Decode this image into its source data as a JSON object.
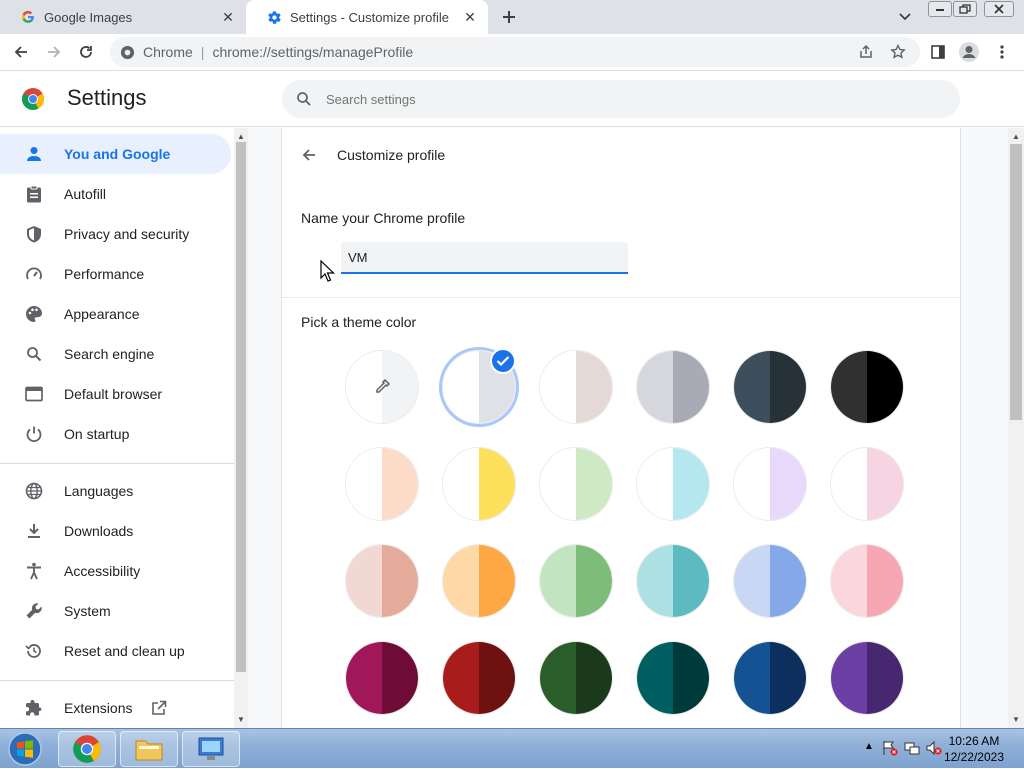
{
  "tabs": [
    {
      "title": "Google Images",
      "icon": "google-g-icon"
    },
    {
      "title": "Settings - Customize profile",
      "icon": "settings-gear-icon"
    }
  ],
  "toolbar": {
    "site_name": "Chrome",
    "separator": "|",
    "url": "chrome://settings/manageProfile"
  },
  "header": {
    "title": "Settings",
    "search_placeholder": "Search settings"
  },
  "sidebar": {
    "items": [
      {
        "label": "You and Google",
        "icon": "person-icon",
        "active": true
      },
      {
        "label": "Autofill",
        "icon": "clipboard-icon"
      },
      {
        "label": "Privacy and security",
        "icon": "shield-icon"
      },
      {
        "label": "Performance",
        "icon": "speedometer-icon"
      },
      {
        "label": "Appearance",
        "icon": "palette-icon"
      },
      {
        "label": "Search engine",
        "icon": "search-icon"
      },
      {
        "label": "Default browser",
        "icon": "browser-window-icon"
      },
      {
        "label": "On startup",
        "icon": "power-icon"
      },
      {
        "label": "Languages",
        "icon": "globe-icon"
      },
      {
        "label": "Downloads",
        "icon": "download-icon"
      },
      {
        "label": "Accessibility",
        "icon": "accessibility-icon"
      },
      {
        "label": "System",
        "icon": "wrench-icon"
      },
      {
        "label": "Reset and clean up",
        "icon": "history-reset-icon"
      },
      {
        "label": "Extensions",
        "icon": "puzzle-icon",
        "external": true
      }
    ]
  },
  "main": {
    "subtitle": "Customize profile",
    "name_label": "Name your Chrome profile",
    "name_value": "VM",
    "color_label": "Pick a theme color",
    "selected_swatch_index": 1,
    "swatches": [
      {
        "left": "#ffffff",
        "right": "#f1f3f4",
        "type": "custom"
      },
      {
        "left": "#ffffff",
        "right": "#dee1e6"
      },
      {
        "left": "#ffffff",
        "right": "#e5d9d7"
      },
      {
        "left": "#d6d7dc",
        "right": "#a8abb5"
      },
      {
        "left": "#3d4f5c",
        "right": "#263238"
      },
      {
        "left": "#303030",
        "right": "#000000"
      },
      {
        "left": "#ffffff",
        "right": "#fcdbc8"
      },
      {
        "left": "#ffffff",
        "right": "#fde15d"
      },
      {
        "left": "#ffffff",
        "right": "#cdeac4"
      },
      {
        "left": "#ffffff",
        "right": "#b5e7f0"
      },
      {
        "left": "#ffffff",
        "right": "#e8d9fb"
      },
      {
        "left": "#ffffff",
        "right": "#f7d4e2"
      },
      {
        "left": "#f2d8d2",
        "right": "#e4ab9b"
      },
      {
        "left": "#fed8a6",
        "right": "#fda745"
      },
      {
        "left": "#c3e4c0",
        "right": "#7dbd7a"
      },
      {
        "left": "#ace0e3",
        "right": "#5dbac0"
      },
      {
        "left": "#c7d7f4",
        "right": "#85a9e8"
      },
      {
        "left": "#fbd6dc",
        "right": "#f7a7b3"
      },
      {
        "left": "#a0175a",
        "right": "#6e0c37"
      },
      {
        "left": "#a81c1c",
        "right": "#6d1111"
      },
      {
        "left": "#2a5d2a",
        "right": "#1b3a1b"
      },
      {
        "left": "#005f60",
        "right": "#003b3c"
      },
      {
        "left": "#155293",
        "right": "#0c2f5d"
      },
      {
        "left": "#6c3fa5",
        "right": "#472770"
      }
    ]
  },
  "taskbar": {
    "time": "10:26 AM",
    "date": "12/22/2023"
  },
  "colors": {
    "accent": "#1a73e8",
    "active_nav_bg": "#e8f0fe"
  }
}
